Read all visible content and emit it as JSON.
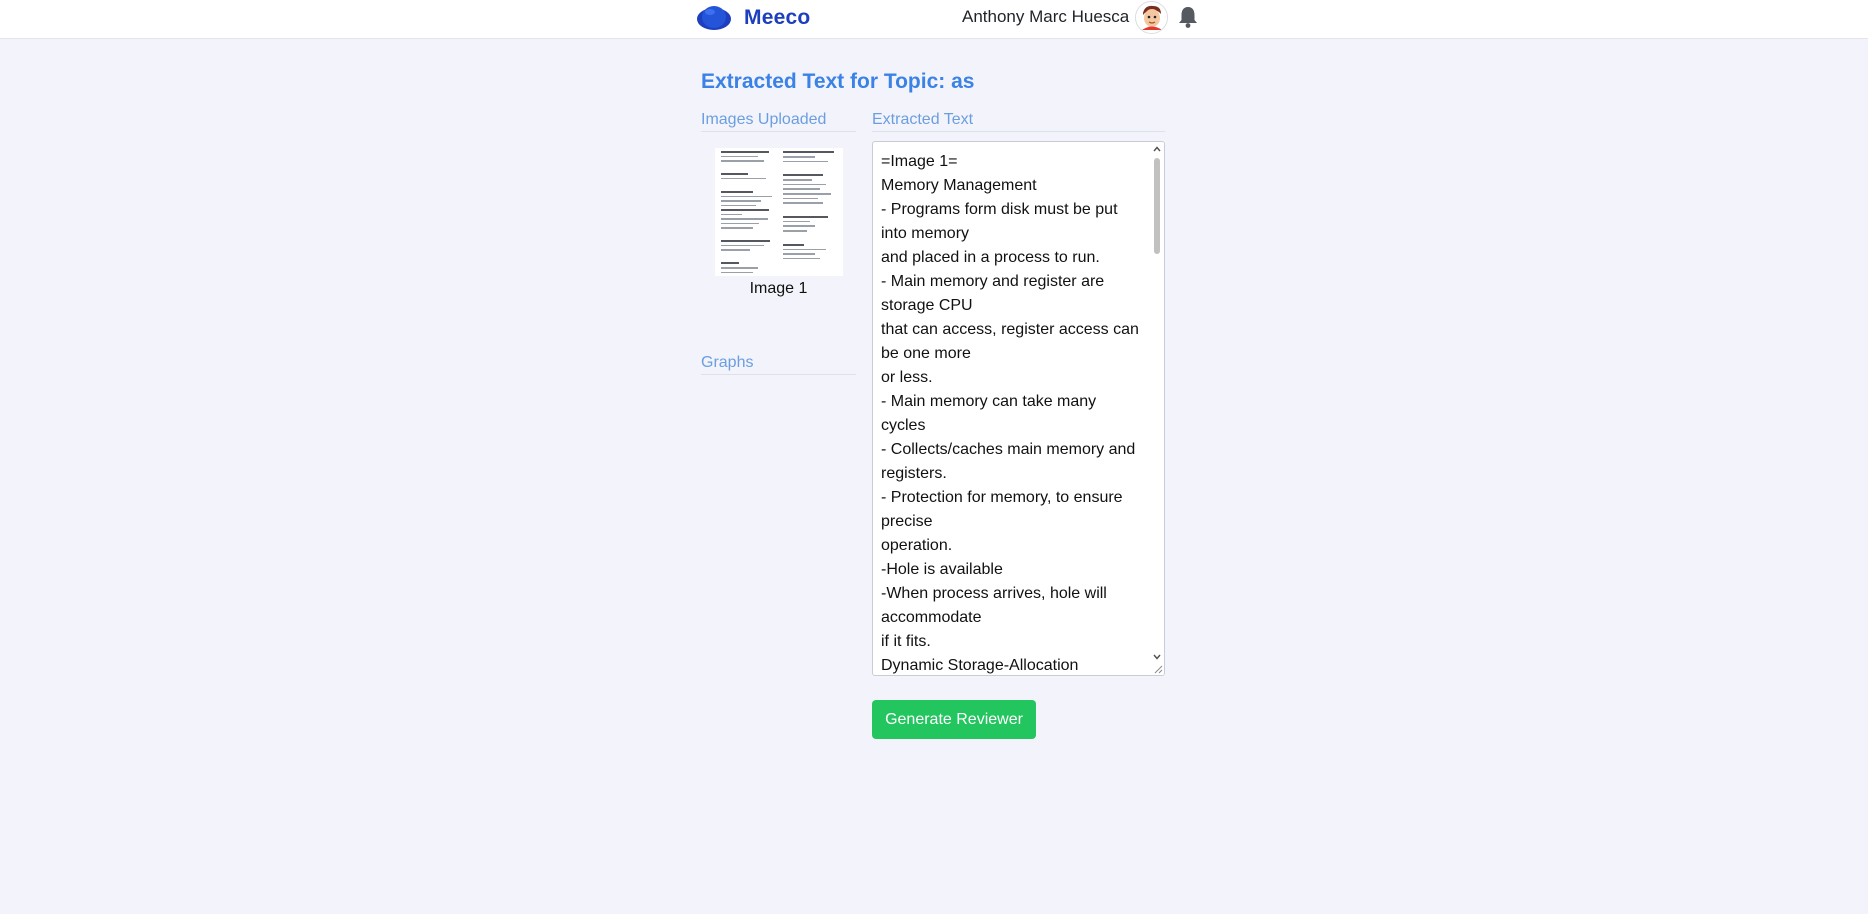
{
  "header": {
    "brand": "Meeco",
    "user_name": "Anthony Marc Huesca",
    "logo_icon": "helmet-logo-icon",
    "notification_icon": "bell-icon"
  },
  "page": {
    "title": "Extracted Text for Topic: as"
  },
  "images_section": {
    "heading": "Images Uploaded",
    "items": [
      {
        "caption": "Image 1"
      }
    ]
  },
  "graphs_section": {
    "heading": "Graphs"
  },
  "extracted_section": {
    "heading": "Extracted Text",
    "text": "=Image 1=\nMemory Management\n- Programs form disk must be put into memory\nand placed in a process to run.\n- Main memory and register are storage CPU\nthat can access, register access can be one more\nor less.\n- Main memory can take many cycles\n- Collects/caches main memory and registers.\n- Protection for memory, to ensure precise\noperation.\n-Hole is available\n-When process arrives, hole will accommodate\nif it fits.\nDynamic Storage-Allocation"
  },
  "actions": {
    "generate_label": "Generate Reviewer"
  },
  "colors": {
    "accent": "#3b82e6",
    "brand": "#1d3fbf",
    "button": "#22c55e",
    "background": "#f3f4fb"
  }
}
